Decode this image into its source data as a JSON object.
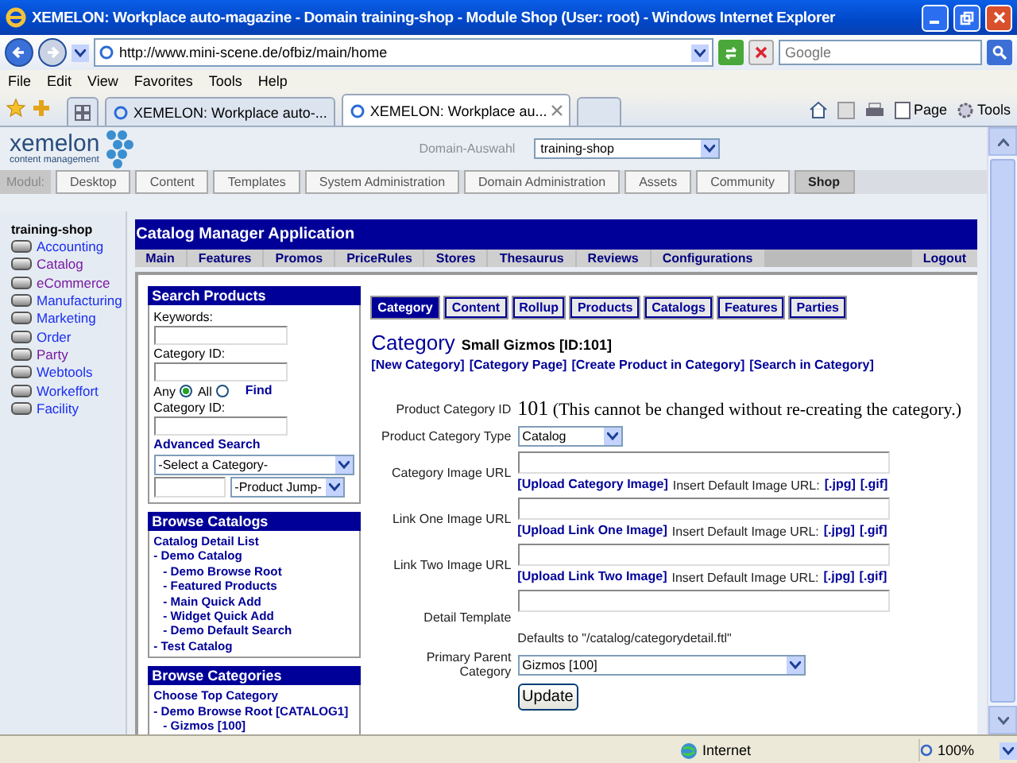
{
  "window": {
    "title": "XEMELON: Workplace auto-magazine - Domain training-shop - Module Shop (User: root) - Windows Internet Explorer"
  },
  "address_bar": {
    "url": "http://www.mini-scene.de/ofbiz/main/home",
    "search_placeholder": "Google"
  },
  "menu": [
    "File",
    "Edit",
    "View",
    "Favorites",
    "Tools",
    "Help"
  ],
  "browser_tabs": [
    {
      "label": "XEMELON: Workplace auto-...",
      "selected": false
    },
    {
      "label": "XEMELON: Workplace au...",
      "selected": true
    }
  ],
  "command_bar": [
    "Page",
    "Tools"
  ],
  "header": {
    "logo_name": "xemelon",
    "logo_sub": "content management",
    "domain_label": "Domain-Auswahl",
    "domain_value": "training-shop"
  },
  "modules": {
    "label": "Modul:",
    "tabs": [
      {
        "label": "Desktop",
        "selected": false
      },
      {
        "label": "Content",
        "selected": false
      },
      {
        "label": "Templates",
        "selected": false
      },
      {
        "label": "System Administration",
        "selected": false
      },
      {
        "label": "Domain Administration",
        "selected": false
      },
      {
        "label": "Assets",
        "selected": false
      },
      {
        "label": "Community",
        "selected": false
      },
      {
        "label": "Shop",
        "selected": true
      }
    ]
  },
  "sidebar": {
    "title": "training-shop",
    "items": [
      {
        "label": "Accounting",
        "visited": false
      },
      {
        "label": "Catalog",
        "visited": true
      },
      {
        "label": "eCommerce",
        "visited": true
      },
      {
        "label": "Manufacturing",
        "visited": false
      },
      {
        "label": "Marketing",
        "visited": false
      },
      {
        "label": "Order",
        "visited": false
      },
      {
        "label": "Party",
        "visited": true
      },
      {
        "label": "Webtools",
        "visited": false
      },
      {
        "label": "Workeffort",
        "visited": false
      },
      {
        "label": "Facility",
        "visited": false
      }
    ]
  },
  "app": {
    "title": "Catalog Manager Application",
    "nav": [
      "Main",
      "Features",
      "Promos",
      "PriceRules",
      "Stores",
      "Thesaurus",
      "Reviews",
      "Configurations"
    ],
    "logout": "Logout"
  },
  "search_products": {
    "title": "Search Products",
    "keywords_label": "Keywords:",
    "category_id_label": "Category ID:",
    "match": [
      {
        "label": "Any",
        "selected": true
      },
      {
        "label": "All",
        "selected": false
      }
    ],
    "find": "Find",
    "category_id_label_2": "Category ID:",
    "advanced": "Advanced Search",
    "category_select": "-Select a Category-",
    "product_jump": "-Product Jump-"
  },
  "browse_catalogs": {
    "title": "Browse Catalogs",
    "items": [
      {
        "label": "Catalog Detail List"
      },
      {
        "label": "- Demo Catalog",
        "children": [
          {
            "label": "- Demo Browse Root"
          },
          {
            "label": "- Featured Products"
          },
          {
            "label": "- Main Quick Add"
          },
          {
            "label": "- Widget Quick Add"
          },
          {
            "label": "- Demo Default Search"
          }
        ]
      },
      {
        "label": "- Test Catalog"
      }
    ]
  },
  "browse_categories": {
    "title": "Browse Categories",
    "items": [
      {
        "label": "Choose Top Category"
      },
      {
        "label": "- Demo Browse Root [CATALOG1]",
        "children": [
          {
            "label": "- Gizmos [100]"
          }
        ]
      }
    ]
  },
  "category_tabs": [
    {
      "label": "Category",
      "selected": true
    },
    {
      "label": "Content",
      "selected": false
    },
    {
      "label": "Rollup",
      "selected": false
    },
    {
      "label": "Products",
      "selected": false
    },
    {
      "label": "Catalogs",
      "selected": false
    },
    {
      "label": "Features",
      "selected": false
    },
    {
      "label": "Parties",
      "selected": false
    }
  ],
  "category": {
    "heading": "Category",
    "name": "Small Gizmos [ID:101]",
    "links": [
      "[New Category]",
      "[Category Page]",
      "[Create Product in Category]",
      "[Search in Category]"
    ]
  },
  "form": [
    {
      "kind": "static",
      "label": "Product Category ID",
      "value": "101",
      "note": "(This cannot be changed without re-creating the category.)"
    },
    {
      "kind": "select",
      "label": "Product Category Type",
      "value": "Catalog"
    },
    {
      "kind": "image",
      "label": "Category Image URL",
      "upload": "[Upload Category Image]",
      "insert": "Insert Default Image URL:",
      "links": [
        "[.jpg]",
        "[.gif]"
      ]
    },
    {
      "kind": "image",
      "label": "Link One Image URL",
      "upload": "[Upload Link One Image]",
      "insert": "Insert Default Image URL:",
      "links": [
        "[.jpg]",
        "[.gif]"
      ]
    },
    {
      "kind": "image",
      "label": "Link Two Image URL",
      "upload": "[Upload Link Two Image]",
      "insert": "Insert Default Image URL:",
      "links": [
        "[.jpg]",
        "[.gif]"
      ]
    },
    {
      "kind": "text",
      "label": "Detail Template",
      "hint": "Defaults to \"/catalog/categorydetail.ftl\""
    },
    {
      "kind": "wideselect",
      "label": "Primary Parent Category",
      "value": "Gizmos [100]"
    }
  ],
  "submit": "Update",
  "status_bar": {
    "zone": "Internet",
    "zoom": "100%"
  }
}
